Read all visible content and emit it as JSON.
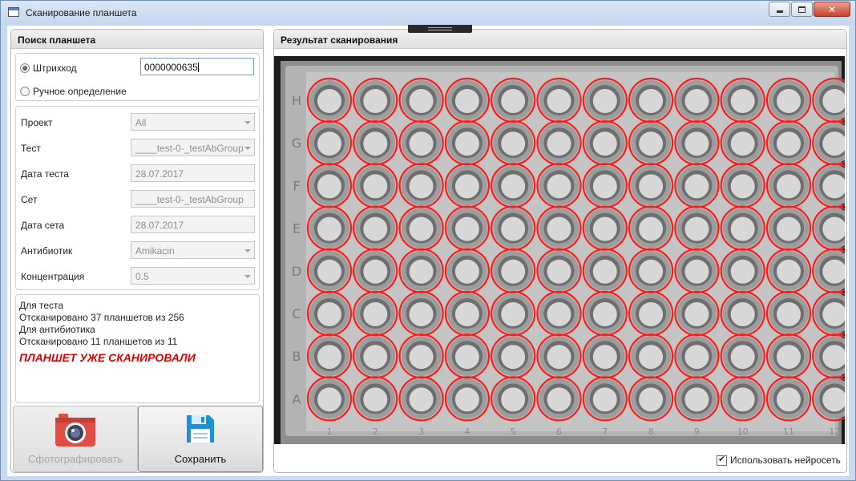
{
  "window": {
    "title": "Сканирование планшета"
  },
  "search": {
    "header": "Поиск планшета",
    "barcode_label": "Штрихкод",
    "barcode_value": "0000000635",
    "manual_label": "Ручное определение",
    "barcode_selected": true
  },
  "details": {
    "fields": [
      {
        "label": "Проект",
        "value": "All",
        "kind": "combo"
      },
      {
        "label": "Тест",
        "value": "____test-0-_testAbGroup",
        "kind": "combo"
      },
      {
        "label": "Дата теста",
        "value": "28.07.2017",
        "kind": "text"
      },
      {
        "label": "Сет",
        "value": "____test-0-_testAbGroup",
        "kind": "text"
      },
      {
        "label": "Дата сета",
        "value": "28.07.2017",
        "kind": "text"
      },
      {
        "label": "Антибиотик",
        "value": "Amikacin",
        "kind": "combo"
      },
      {
        "label": "Концентрация",
        "value": "0.5",
        "kind": "combo"
      }
    ]
  },
  "status": {
    "lines": [
      "Для теста",
      "Отсканировано 37 планшетов из 256",
      "Для антибиотика",
      "Отсканировано 11 планшетов из 11"
    ],
    "alert": "ПЛАНШЕТ УЖЕ СКАНИРОВАЛИ"
  },
  "actions": {
    "photo_label": "Сфотографировать",
    "photo_enabled": false,
    "save_label": "Сохранить"
  },
  "result": {
    "header": "Результат сканирования",
    "plate": {
      "rows": 8,
      "columns": 12,
      "row_letters": [
        "H",
        "G",
        "F",
        "E",
        "D",
        "C",
        "B",
        "A"
      ],
      "column_numbers": [
        "1",
        "2",
        "3",
        "4",
        "5",
        "6",
        "7",
        "8",
        "9",
        "10",
        "11",
        "12"
      ],
      "detection_color": "#ff1a1a"
    },
    "use_neural_net_label": "Использовать нейросеть",
    "use_neural_net": true
  },
  "colors": {
    "alert": "#e00000",
    "camera_icon": "#e0453a",
    "save_icon": "#1f8fd6"
  }
}
